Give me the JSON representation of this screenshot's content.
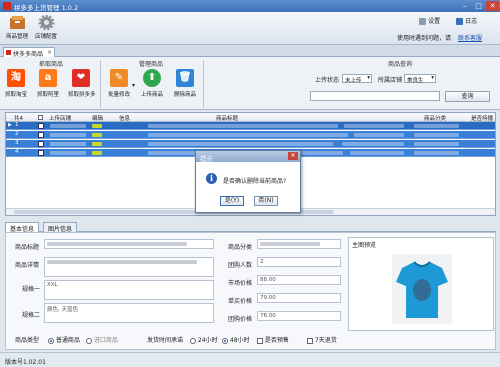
{
  "window": {
    "title": "拼多多上货管理 1.0.2"
  },
  "toolbar": {
    "buttons": [
      {
        "label": "商品管理",
        "icon": "product-manage-icon"
      },
      {
        "label": "店铺配置",
        "icon": "gear-icon"
      }
    ],
    "settings_label": "设置",
    "log_label": "日志",
    "help_text": "使用时遇到问题，请",
    "contact_link": "联系客服"
  },
  "tab": {
    "label": "拼多多商品"
  },
  "ribbon": {
    "groups": {
      "grab": "抓取商品",
      "manage": "管理商品",
      "query": "商品查询"
    },
    "buttons": [
      {
        "label": "抓取淘宝",
        "icon": "taobao-icon",
        "glyph": "淘",
        "color": "#ff5000"
      },
      {
        "label": "抓取阿里",
        "icon": "alibaba-icon",
        "glyph": "a",
        "color": "#ff7a1a"
      },
      {
        "label": "抓取拼多多",
        "icon": "pinduoduo-icon",
        "glyph": "❤",
        "color": "#e02e24"
      },
      {
        "label": "批量修改",
        "icon": "edit-icon",
        "glyph": "✎",
        "color": "#f08a24"
      },
      {
        "label": "上传商品",
        "icon": "upload-icon",
        "glyph": "⬆",
        "color": "#2fa84f"
      },
      {
        "label": "删除商品",
        "icon": "trash-icon",
        "glyph": "🗑",
        "color": "#2f86d6"
      }
    ],
    "query": {
      "upload_status_label": "上传状态",
      "upload_status_value": "未上传",
      "store_label": "所属店铺",
      "store_value": "美良生",
      "search_button": "查询"
    }
  },
  "grid": {
    "columns": [
      "共4",
      "上传店铺",
      "编辑",
      "信息",
      "商品标题",
      "商品分类",
      "是否持播"
    ],
    "rows": [
      {
        "num": "1"
      },
      {
        "num": "2"
      },
      {
        "num": "3"
      },
      {
        "num": "4"
      }
    ]
  },
  "dialog": {
    "title": "提示",
    "icon_glyph": "i",
    "message": "是否确认删除当前商品?",
    "yes": "是(Y)",
    "no": "否(N)"
  },
  "detail_tabs": [
    "基本信息",
    "图片信息"
  ],
  "detail": {
    "title_label": "商品标题",
    "desc_label": "商品详情",
    "spec1_label": "规格一",
    "spec1_value": "XXL",
    "spec2_label": "规格二",
    "spec2_value": "颜色, 天蓝色",
    "category_label": "商品分类",
    "group_count_label": "团购人数",
    "group_count_value": "2",
    "market_price_label": "市场价格",
    "market_price_value": "88.00",
    "single_price_label": "单买价格",
    "single_price_value": "79.00",
    "group_price_label": "团购价格",
    "group_price_value": "76.00",
    "main_image_label": "主图预览",
    "product_type_label": "商品类型",
    "type_normal": "普通商品",
    "type_import": "进口商品",
    "ship_time_label": "发货时间承诺",
    "ship_24": "24小时",
    "ship_48": "48小时",
    "preorder_label": "是否预售",
    "seven_day_label": "7天退货"
  },
  "status": {
    "version": "版本号1.02.01"
  }
}
